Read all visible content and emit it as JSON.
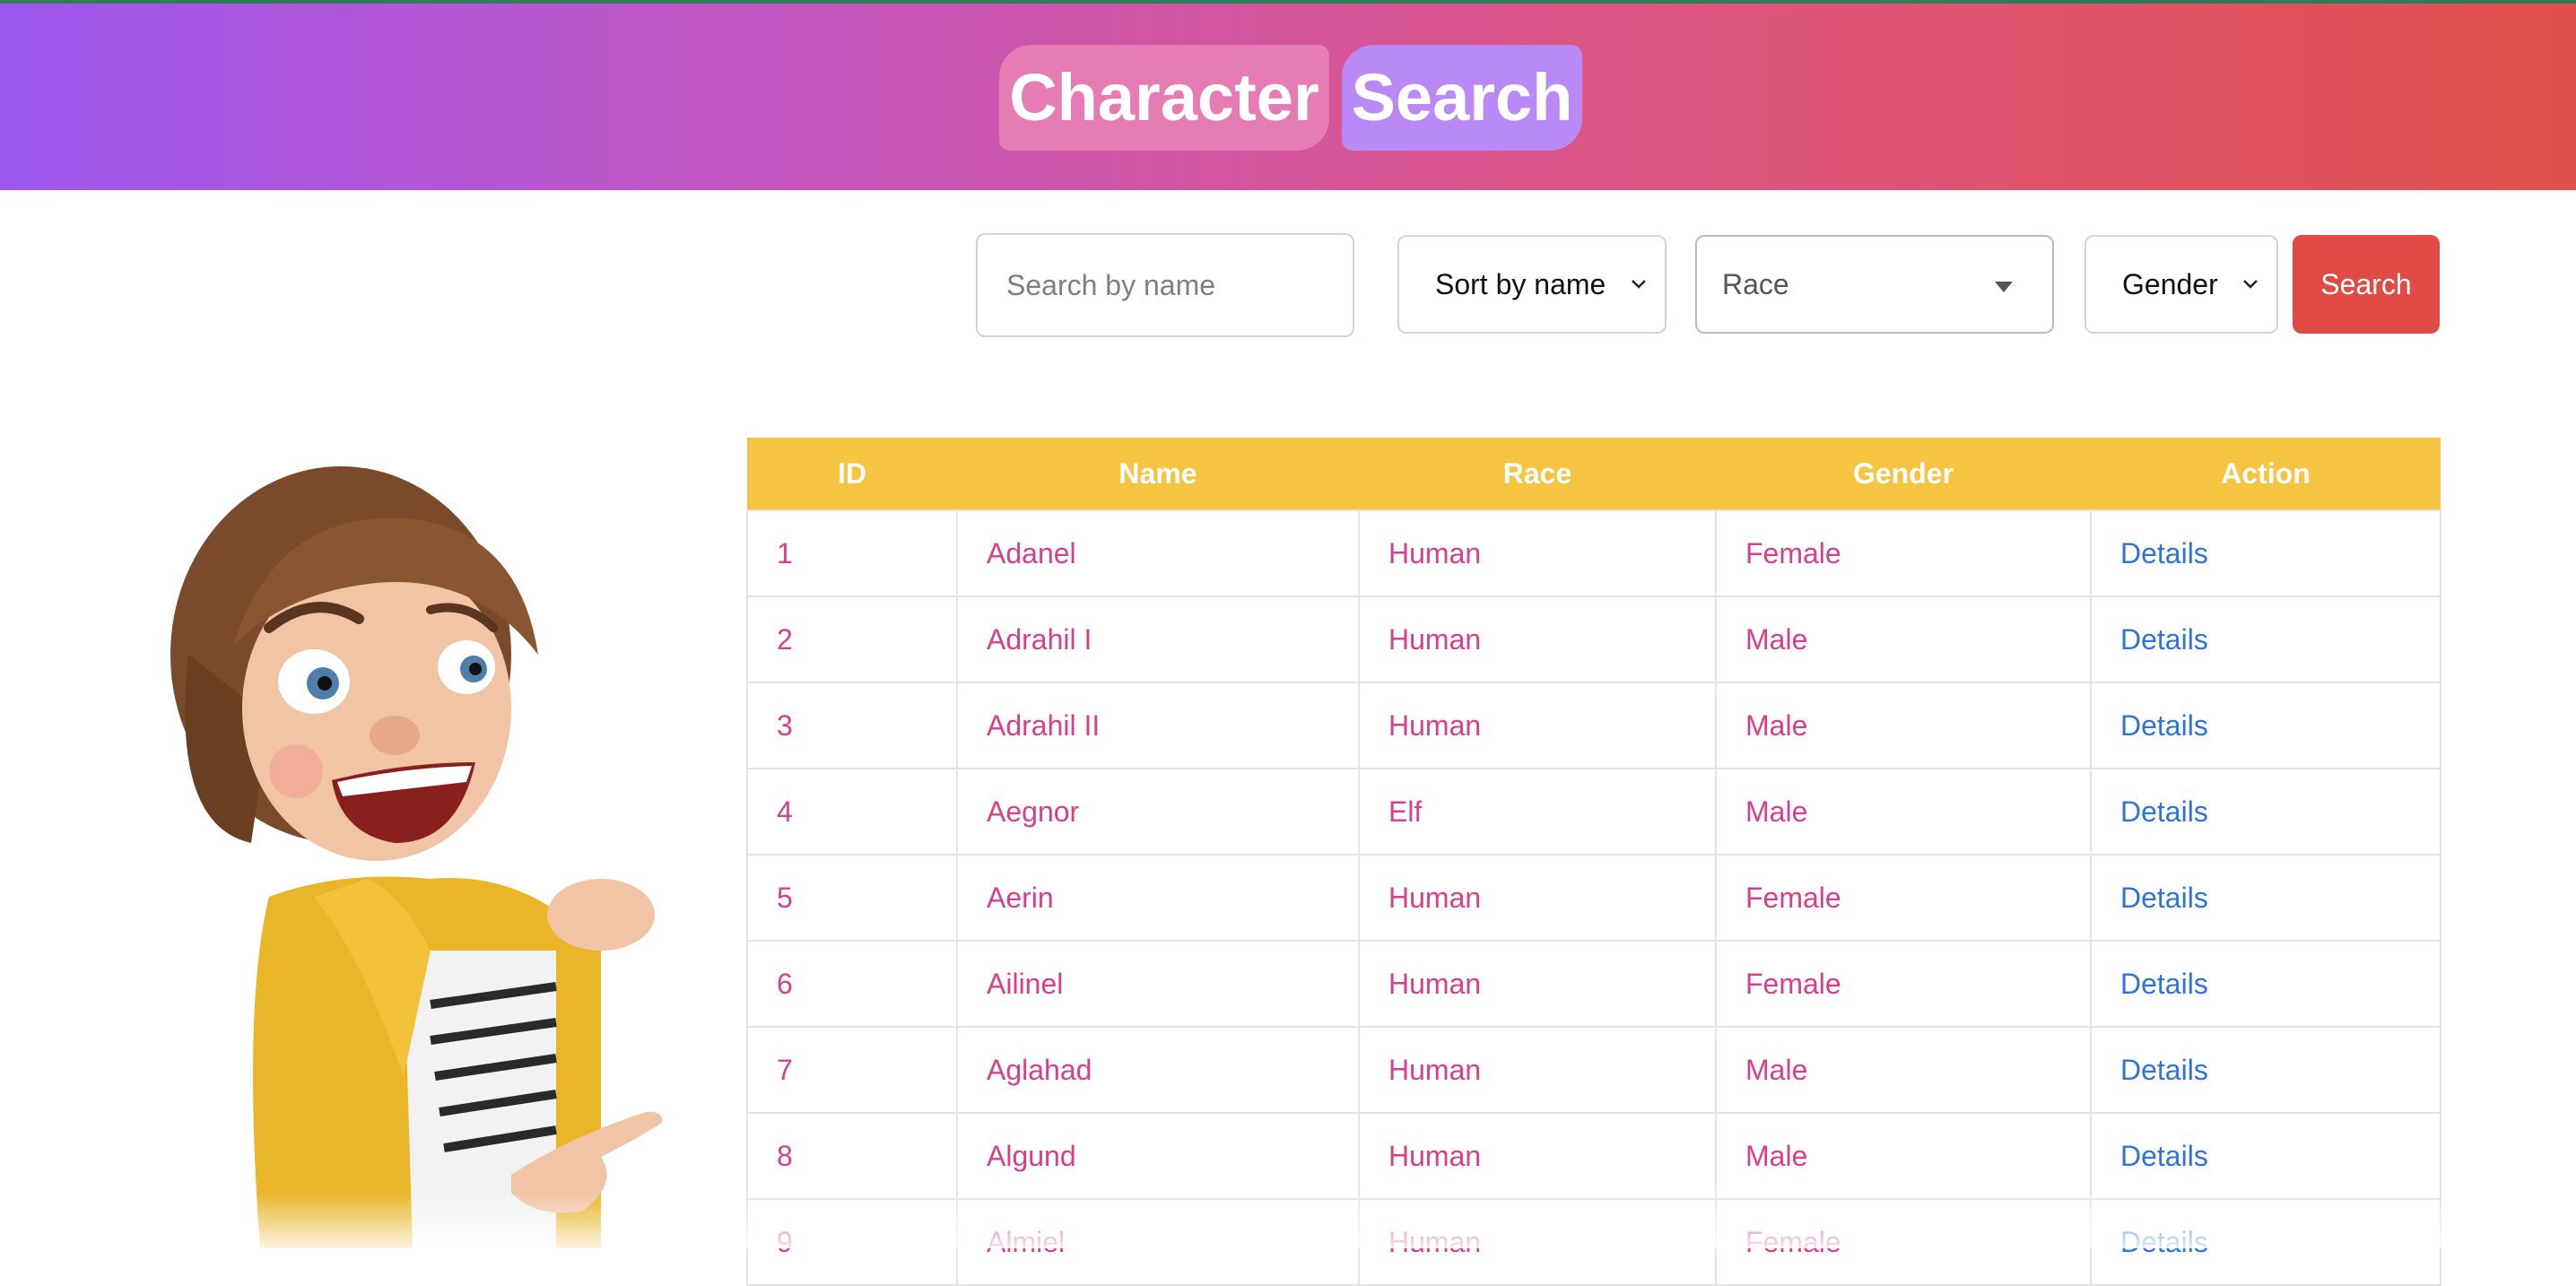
{
  "header": {
    "title_word_1": "Character",
    "title_word_2": "Search"
  },
  "filters": {
    "search_placeholder": "Search by name",
    "sort_label": "Sort by name",
    "race_label": "Race",
    "gender_label": "Gender",
    "search_button": "Search"
  },
  "table": {
    "columns": [
      "ID",
      "Name",
      "Race",
      "Gender",
      "Action"
    ],
    "rows": [
      {
        "id": "1",
        "name": "Adanel",
        "race": "Human",
        "gender": "Female",
        "action": "Details"
      },
      {
        "id": "2",
        "name": "Adrahil I",
        "race": "Human",
        "gender": "Male",
        "action": "Details"
      },
      {
        "id": "3",
        "name": "Adrahil II",
        "race": "Human",
        "gender": "Male",
        "action": "Details"
      },
      {
        "id": "4",
        "name": "Aegnor",
        "race": "Elf",
        "gender": "Male",
        "action": "Details"
      },
      {
        "id": "5",
        "name": "Aerin",
        "race": "Human",
        "gender": "Female",
        "action": "Details"
      },
      {
        "id": "6",
        "name": "Ailinel",
        "race": "Human",
        "gender": "Female",
        "action": "Details"
      },
      {
        "id": "7",
        "name": "Aglahad",
        "race": "Human",
        "gender": "Male",
        "action": "Details"
      },
      {
        "id": "8",
        "name": "Algund",
        "race": "Human",
        "gender": "Male",
        "action": "Details"
      },
      {
        "id": "9",
        "name": "Almiel",
        "race": "Human",
        "gender": "Female",
        "action": "Details"
      }
    ]
  },
  "colors": {
    "header_gradient_start": "#9b57ee",
    "header_gradient_end": "#e0504a",
    "table_header_bg": "#f5c542",
    "cell_text": "#d63f8c",
    "link_text": "#2f73d8",
    "search_button_bg": "#e04c45"
  },
  "illustration": {
    "icon": "cartoon-girl-pointing"
  }
}
